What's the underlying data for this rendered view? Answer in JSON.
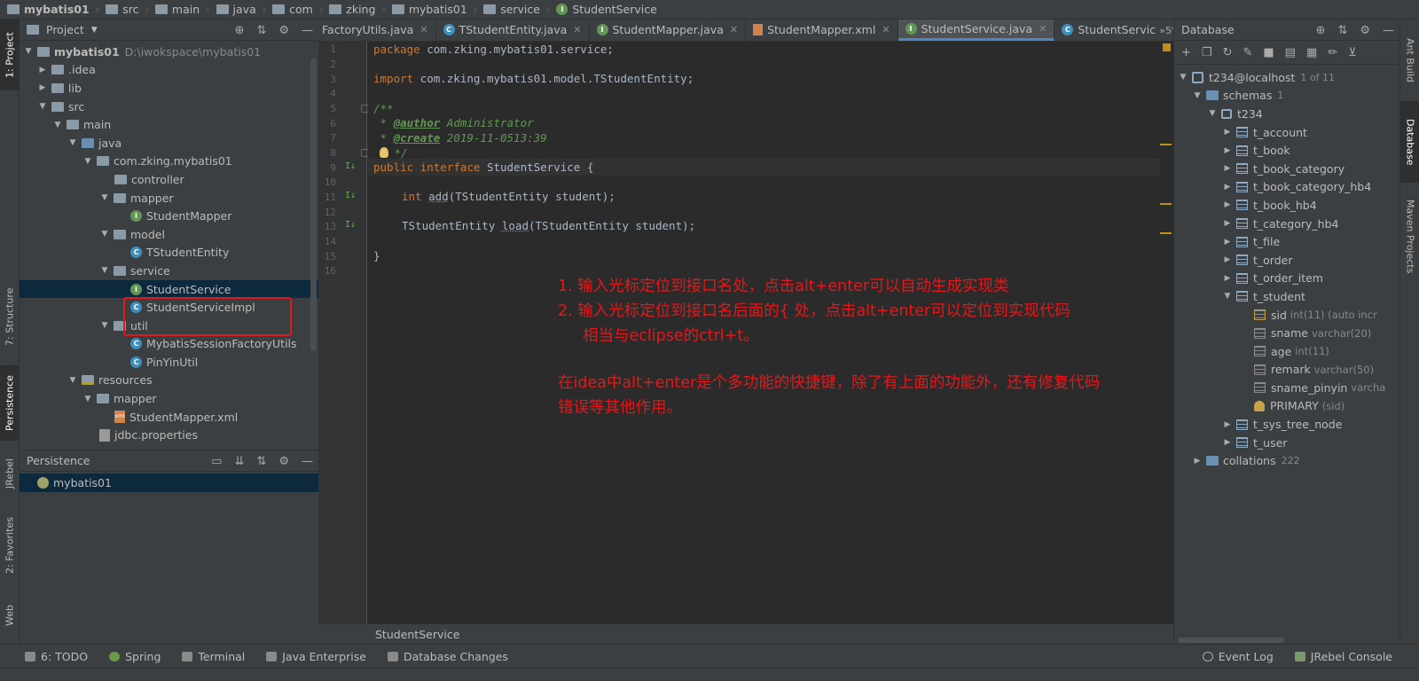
{
  "breadcrumb": [
    "mybatis01",
    "src",
    "main",
    "java",
    "com",
    "zking",
    "mybatis01",
    "service",
    "StudentService"
  ],
  "left_tabs": [
    "1: Project",
    "7: Structure",
    "Persistence",
    "JRebel",
    "2: Favorites",
    "Web"
  ],
  "right_tabs": [
    "Ant Build",
    "Database",
    "Maven Projects"
  ],
  "project": {
    "title": "Project",
    "root_name": "mybatis01",
    "root_path": "D:\\iwokspace\\mybatis01",
    "items": [
      ".idea",
      "lib",
      "src",
      "main",
      "java",
      "com.zking.mybatis01",
      "controller",
      "mapper",
      "StudentMapper",
      "model",
      "TStudentEntity",
      "service",
      "StudentService",
      "StudentServiceImpl",
      "util",
      "MybatisSessionFactoryUtils",
      "PinYinUtil",
      "resources",
      "mapper",
      "StudentMapper.xml",
      "jdbc.properties"
    ]
  },
  "persistence": {
    "title": "Persistence",
    "item": "mybatis01"
  },
  "tabs": [
    {
      "label": "FactoryUtils.java",
      "kind": "c"
    },
    {
      "label": "TStudentEntity.java",
      "kind": "c"
    },
    {
      "label": "StudentMapper.java",
      "kind": "i"
    },
    {
      "label": "StudentMapper.xml",
      "kind": "x"
    },
    {
      "label": "StudentService.java",
      "kind": "i",
      "active": true
    },
    {
      "label": "StudentServiceImpl.java",
      "kind": "c"
    }
  ],
  "tab_overflow": "»5",
  "line_numbers": [
    "1",
    "2",
    "3",
    "4",
    "5",
    "6",
    "7",
    "8",
    "9",
    "10",
    "11",
    "12",
    "13",
    "14",
    "15",
    "16"
  ],
  "code": {
    "l1_kw": "package",
    "l1_rest": " com.zking.mybatis01.service;",
    "l3_kw": "import",
    "l3_rest": " com.zking.mybatis01.model.TStudentEntity;",
    "l5": "/**",
    "l6_pre": " * ",
    "l6_tag": "@author",
    "l6_rest": " Administrator",
    "l7_pre": " * ",
    "l7_tag": "@create",
    "l7_rest": " 2019-11-0513:39",
    "l8": " */",
    "l9_kw1": "public",
    "l9_kw2": "interface",
    "l9_rest": " StudentService {",
    "l11_kw": "int",
    "l11_name": "add",
    "l11_rest": "(TStudentEntity student);",
    "l13_type": "TStudentEntity ",
    "l13_name": "load",
    "l13_rest": "(TStudentEntity student);",
    "l15": "}"
  },
  "annotations": {
    "line1": "1.  输入光标定位到接口名处，点击alt+enter可以自动生成实现类",
    "line2": "2.  输入光标定位到接口名后面的{  处，点击alt+enter可以定位到实现代码",
    "line3": "相当与eclipse的ctrl+t。",
    "line4": "在idea中alt+enter是个多功能的快捷键，除了有上面的功能外，还有修复代码",
    "line5": "错误等其他作用。",
    "color": "#e3181a"
  },
  "editor_footer": "StudentService",
  "database": {
    "title": "Database",
    "host": "t234@localhost",
    "host_count": "1 of 11",
    "schemas": "schemas",
    "schemas_count": "1",
    "schema": "t234",
    "tables": [
      "t_account",
      "t_book",
      "t_book_category",
      "t_book_category_hb4",
      "t_book_hb4",
      "t_category_hb4",
      "t_file",
      "t_order",
      "t_order_item",
      "t_student"
    ],
    "columns": [
      {
        "name": "sid",
        "type": "int(11) (auto incr"
      },
      {
        "name": "sname",
        "type": "varchar(20)"
      },
      {
        "name": "age",
        "type": "int(11)"
      },
      {
        "name": "remark",
        "type": "varchar(50)"
      },
      {
        "name": "sname_pinyin",
        "type": "varcha"
      }
    ],
    "primary": "PRIMARY",
    "primary_cols": "(sid)",
    "more_tables": [
      "t_sys_tree_node",
      "t_user"
    ],
    "collations": "collations",
    "collations_count": "222"
  },
  "bottom_tools": [
    "6: TODO",
    "Spring",
    "Terminal",
    "Java Enterprise",
    "Database Changes"
  ],
  "bottom_right": [
    "Event Log",
    "JRebel Console"
  ],
  "colors": {
    "keyword": "#cc7832",
    "comment": "#629755",
    "selection": "#0d293e",
    "accent": "#4a88c7"
  }
}
